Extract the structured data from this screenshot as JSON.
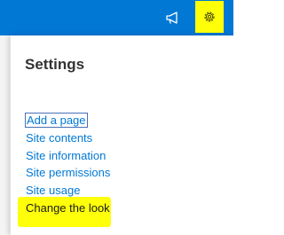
{
  "topbar": {
    "background": "#0078d4",
    "icons": [
      "megaphone-icon",
      "gear-icon"
    ],
    "highlight_color": "#ffff0a"
  },
  "settings_panel": {
    "title": "Settings",
    "items": [
      {
        "label": "Add a page"
      },
      {
        "label": "Site contents"
      },
      {
        "label": "Site information"
      },
      {
        "label": "Site permissions"
      },
      {
        "label": "Site usage"
      },
      {
        "label": "Change the look"
      }
    ],
    "link_color": "#0078d4"
  }
}
